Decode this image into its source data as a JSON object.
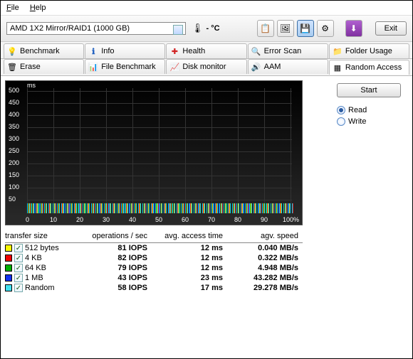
{
  "menu": {
    "file": "File",
    "help": "Help"
  },
  "toolbar": {
    "drive_label": "AMD    1X2 Mirror/RAID1 (1000 GB)",
    "temp": "- °C",
    "exit": "Exit"
  },
  "tabs_row1": [
    {
      "label": "Benchmark",
      "color": "#f0c000"
    },
    {
      "label": "Info",
      "color": "#2060c0"
    },
    {
      "label": "Health",
      "color": "#d02020"
    },
    {
      "label": "Error Scan",
      "color": "#20a020"
    },
    {
      "label": "Folder Usage",
      "color": "#d0a020"
    }
  ],
  "tabs_row2": [
    {
      "label": "Erase",
      "color": "#808080"
    },
    {
      "label": "File Benchmark",
      "color": "#c040c0"
    },
    {
      "label": "Disk monitor",
      "color": "#40a0e0"
    },
    {
      "label": "AAM",
      "color": "#e0c020"
    },
    {
      "label": "Random Access",
      "color": "#c0a060",
      "active": true
    }
  ],
  "side": {
    "start": "Start",
    "read": "Read",
    "write": "Write"
  },
  "chart_data": {
    "type": "scatter",
    "title": "",
    "xlabel": "%",
    "ylabel": "ms",
    "ylim": [
      0,
      500
    ],
    "xlim": [
      0,
      100
    ],
    "yticks": [
      50,
      100,
      150,
      200,
      250,
      300,
      350,
      400,
      450,
      500
    ],
    "xticks": [
      0,
      10,
      20,
      30,
      40,
      50,
      60,
      70,
      80,
      90,
      100
    ]
  },
  "table": {
    "headers": [
      "transfer size",
      "operations / sec",
      "avg. access time",
      "agv. speed"
    ],
    "rows": [
      {
        "swatch": "#f8f800",
        "label": "512 bytes",
        "iops": "81 IOPS",
        "time": "12 ms",
        "speed": "0.040 MB/s"
      },
      {
        "swatch": "#f00000",
        "label": "4 KB",
        "iops": "82 IOPS",
        "time": "12 ms",
        "speed": "0.322 MB/s"
      },
      {
        "swatch": "#00b000",
        "label": "64 KB",
        "iops": "79 IOPS",
        "time": "12 ms",
        "speed": "4.948 MB/s"
      },
      {
        "swatch": "#1030f0",
        "label": "1 MB",
        "iops": "43 IOPS",
        "time": "23 ms",
        "speed": "43.282 MB/s"
      },
      {
        "swatch": "#40e0f0",
        "label": "Random",
        "iops": "58 IOPS",
        "time": "17 ms",
        "speed": "29.278 MB/s"
      }
    ]
  }
}
